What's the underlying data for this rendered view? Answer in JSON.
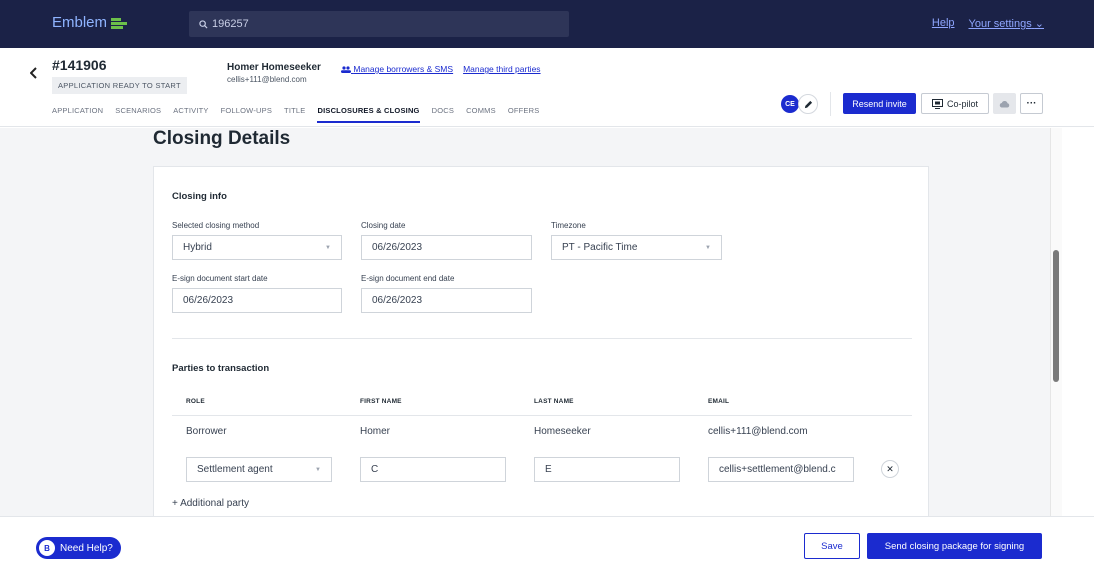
{
  "topbar": {
    "logo_text": "Emblem",
    "search_value": "196257",
    "help_link": "Help",
    "settings_link": "Your settings",
    "bg_color": "#1b2247"
  },
  "header": {
    "loan_number": "#141906",
    "status_badge": "APPLICATION READY TO START",
    "borrower_name": "Homer Homeseeker",
    "borrower_email": "cellis+111@blend.com",
    "links": [
      "Manage borrowers & SMS",
      "Manage third parties"
    ],
    "tabs": [
      "APPLICATION",
      "SCENARIOS",
      "ACTIVITY",
      "FOLLOW-UPS",
      "TITLE",
      "DISCLOSURES & CLOSING",
      "DOCS",
      "COMMS",
      "OFFERS"
    ],
    "active_tab": "DISCLOSURES & CLOSING",
    "avatar_initials": "CE",
    "resend_label": "Resend invite",
    "copilot_label": "Co-pilot",
    "accent_color": "#1b2bcf"
  },
  "main": {
    "page_title": "Closing Details",
    "closing_info": {
      "title": "Closing info",
      "method_label": "Selected closing method",
      "method_value": "Hybrid",
      "date_label": "Closing date",
      "date_value": "06/26/2023",
      "timezone_label": "Timezone",
      "timezone_value": "PT - Pacific Time",
      "esign_start_label": "E-sign document start date",
      "esign_start_value": "06/26/2023",
      "esign_end_label": "E-sign document end date",
      "esign_end_value": "06/26/2023"
    },
    "parties": {
      "title": "Parties to transaction",
      "columns": [
        "ROLE",
        "FIRST NAME",
        "LAST NAME",
        "EMAIL"
      ],
      "borrower_row": {
        "role": "Borrower",
        "first": "Homer",
        "last": "Homeseeker",
        "email": "cellis+111@blend.com"
      },
      "agent_row": {
        "role": "Settlement agent",
        "first": "C",
        "last": "E",
        "email": "cellis+settlement@blend.c"
      },
      "add_label": "+ Additional party"
    }
  },
  "footer": {
    "help_label": "Need Help?",
    "help_badge": "B",
    "save_label": "Save",
    "send_label": "Send closing package for signing"
  }
}
